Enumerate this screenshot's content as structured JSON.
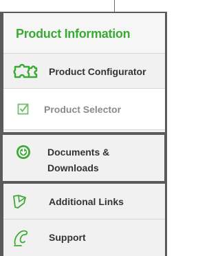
{
  "colors": {
    "accent_green": "#3aaa35",
    "frame_dark": "#5a5a5a",
    "text_dark": "#333333",
    "text_muted": "#8a8a8a"
  },
  "header": {
    "title": "Product Information"
  },
  "menu": {
    "items": [
      {
        "label": "Product Configurator",
        "icon": "puzzle-icon",
        "state": "normal"
      },
      {
        "label": "Product Selector",
        "icon": "checkbox-icon",
        "state": "selected"
      },
      {
        "label_line1": "Documents &",
        "label_line2": "Downloads",
        "icon": "download-icon",
        "state": "active"
      },
      {
        "label": "Additional Links",
        "icon": "link-tag-icon",
        "state": "normal"
      },
      {
        "label": "Support",
        "icon": "phone-icon",
        "state": "normal"
      }
    ]
  }
}
